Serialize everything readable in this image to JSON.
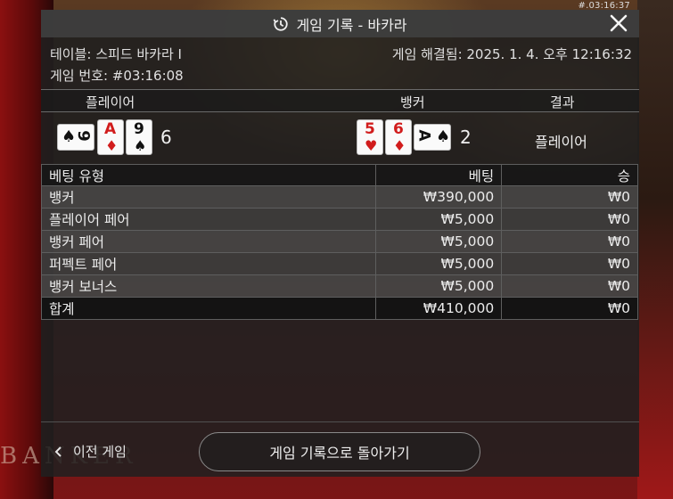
{
  "timestamp_overlay": "#.03:16:37",
  "dialog": {
    "title": "게임 기록 - 바카라",
    "history_icon": "history-clock-icon",
    "close_icon": "close-icon"
  },
  "info": {
    "table": "테이블: 스피드 바카라 I",
    "game_number": "게임 번호: #03:16:08",
    "resolved": "게임 해결됨: 2025. 1. 4. 오후 12:16:32"
  },
  "result": {
    "headers": {
      "player": "플레이어",
      "banker": "뱅커",
      "outcome": "결과"
    },
    "player": {
      "cards": [
        {
          "rank": "9",
          "suit": "♠",
          "color": "black",
          "orientation": "sideways"
        },
        {
          "rank": "A",
          "suit": "♦",
          "color": "red",
          "orientation": "upright"
        },
        {
          "rank": "9",
          "suit": "♠",
          "color": "black",
          "orientation": "upright"
        }
      ],
      "score": "6"
    },
    "banker": {
      "cards": [
        {
          "rank": "5",
          "suit": "♥",
          "color": "red",
          "orientation": "upright"
        },
        {
          "rank": "6",
          "suit": "♦",
          "color": "red",
          "orientation": "upright"
        },
        {
          "rank": "A",
          "suit": "♠",
          "color": "black",
          "orientation": "sideways"
        }
      ],
      "score": "2"
    },
    "outcome": "플레이어"
  },
  "bets": {
    "headers": {
      "type": "베팅 유형",
      "bet": "베팅",
      "win": "승"
    },
    "rows": [
      {
        "type": "뱅커",
        "bet": "₩390,000",
        "win": "₩0"
      },
      {
        "type": "플레이어 페어",
        "bet": "₩5,000",
        "win": "₩0"
      },
      {
        "type": "뱅커 페어",
        "bet": "₩5,000",
        "win": "₩0"
      },
      {
        "type": "퍼펙트 페어",
        "bet": "₩5,000",
        "win": "₩0"
      },
      {
        "type": "뱅커 보너스",
        "bet": "₩5,000",
        "win": "₩0"
      }
    ],
    "total": {
      "type": "합계",
      "bet": "₩410,000",
      "win": "₩0"
    }
  },
  "footer": {
    "prev_label": "이전 게임",
    "prev_icon": "chevron-left-icon",
    "back_label": "게임 기록으로 돌아가기"
  },
  "background": {
    "table_text": "BANKER"
  },
  "colors": {
    "card_red": "#d11c1c",
    "card_black": "#111111",
    "panel_bg": "#202020"
  }
}
